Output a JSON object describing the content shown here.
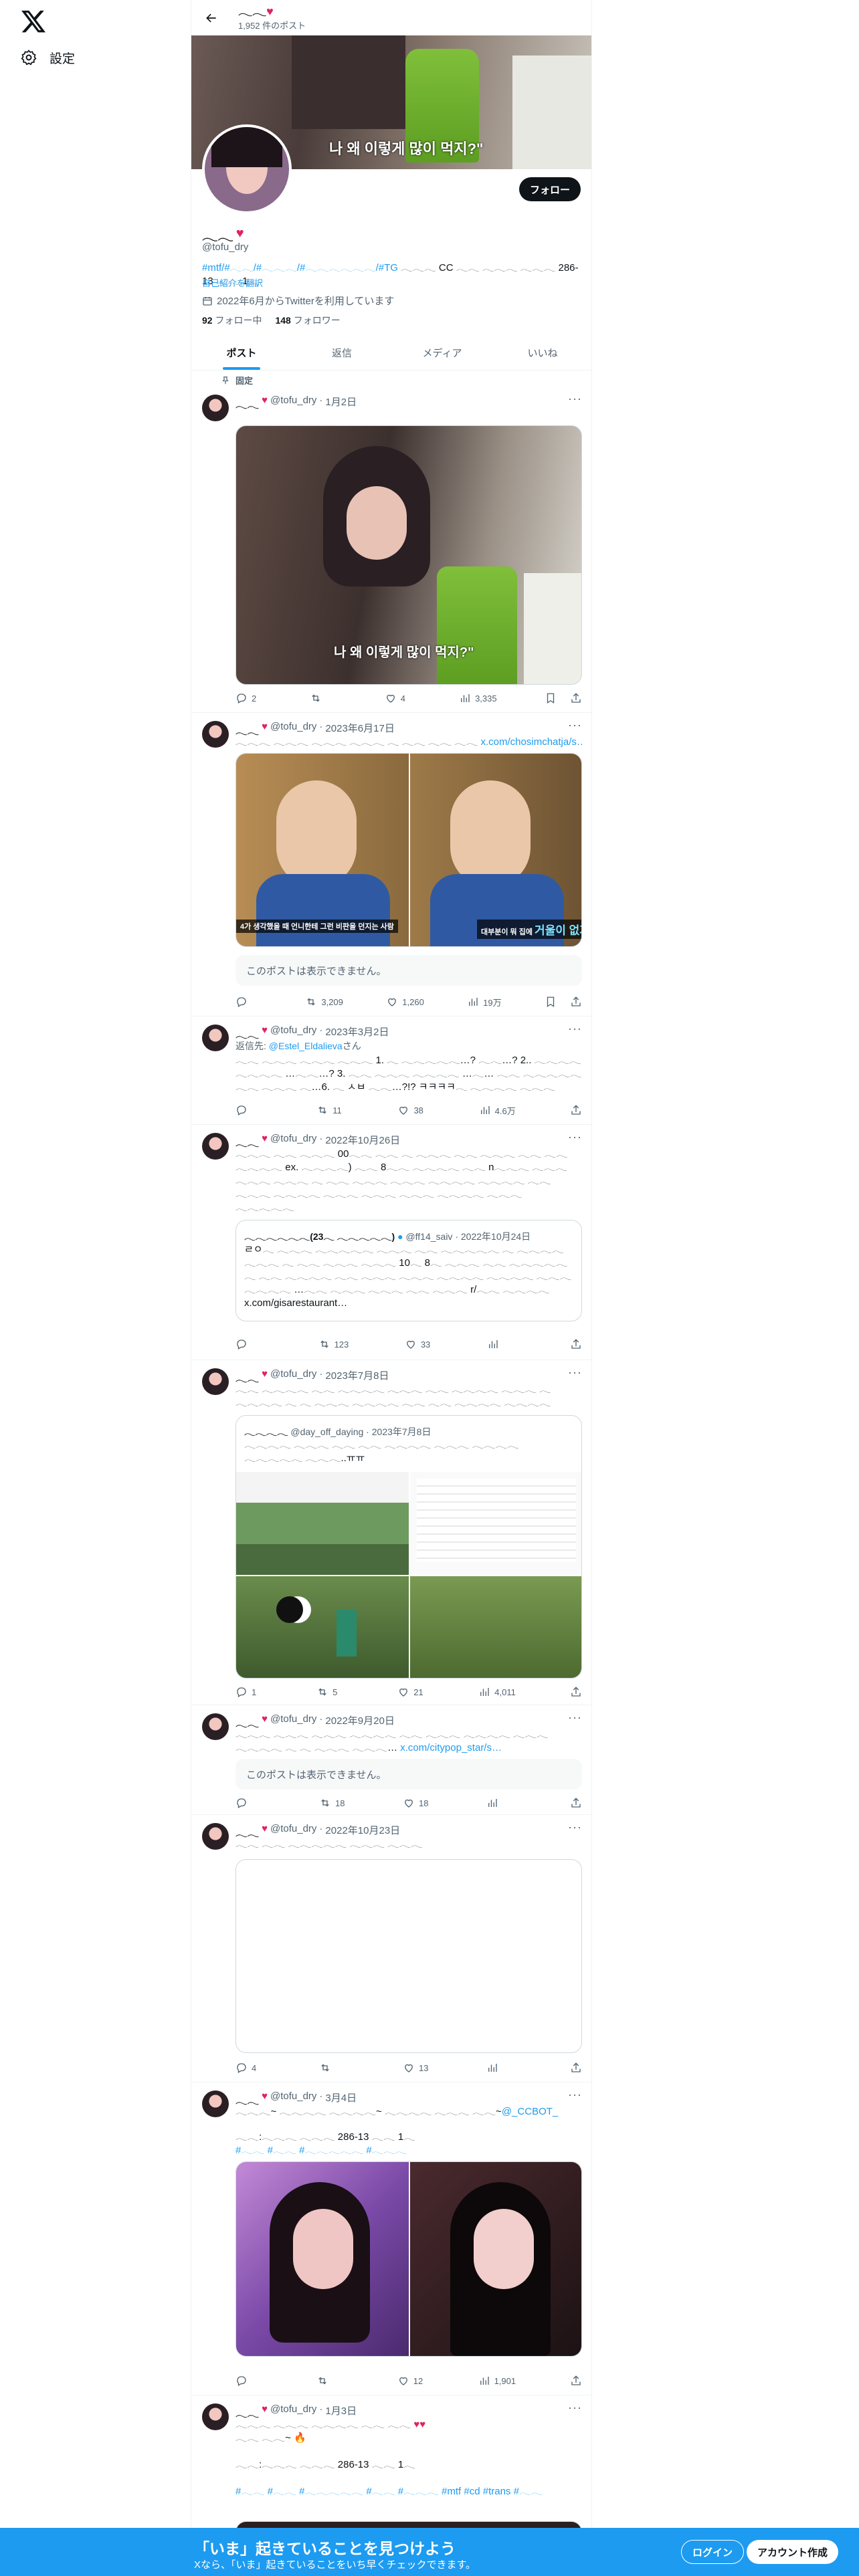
{
  "nav": {
    "settings_label": "設定"
  },
  "header": {
    "name": "𓂃𓂃",
    "post_count": "1,952 件のポスト"
  },
  "banner": {
    "caption": "나 왜 이렇게 많이 먹지?\""
  },
  "profile": {
    "name": "𓂃𓂃",
    "handle": "@tofu_dry",
    "bio_tags": "#mtf/#𓂃𓂃/#𓂃𓂃𓂃/#𓂃𓂃𓂃𓂃𓂃𓂃/#TG",
    "bio_text": " 𓂃𓂃𓂃 CC 𓂃𓂃 𓂃𓂃𓂃 𓂃𓂃𓂃 286-13 𓂃𓂃 1𓂃",
    "translate_label": "自己紹介を翻訳",
    "joined": "2022年6月からTwitterを利用しています",
    "following_count": "92",
    "following_label": "フォロー中",
    "followers_count": "148",
    "followers_label": "フォロワー",
    "follow_button": "フォロー"
  },
  "tabs": [
    "ポスト",
    "返信",
    "メディア",
    "いいね"
  ],
  "pinned_label": "固定",
  "hidden_post_text": "このポストは表示できません。",
  "tweets": [
    {
      "name": "𓂃𓂃",
      "handle": "@tofu_dry",
      "date": "1月2日",
      "text": "",
      "media_caption": "나 왜 이렇게 많이 먹지?\"",
      "replies": "2",
      "retweets": "",
      "likes": "4",
      "views": "3,335"
    },
    {
      "name": "𓂃𓂃",
      "handle": "@tofu_dry",
      "date": "2023年6月17日",
      "text": "𓂃𓂃𓂃 𓂃𓂃𓂃 𓂃𓂃𓂃 𓂃𓂃𓂃 𓂃 𓂃𓂃 𓂃𓂃 𓂃𓂃",
      "link": " x.com/chosimchatja/s…",
      "sub_left": "4가 생각했을 때 언니한테 그런 비판을 던지는 사람",
      "sub_right_small": "대부분이 뭐 집에",
      "sub_right_big": "거울이 없거나",
      "replies": "",
      "retweets": "3,209",
      "likes": "1,260",
      "views": "19万"
    },
    {
      "name": "𓂃𓂃",
      "handle": "@tofu_dry",
      "date": "2023年3月2日",
      "reply_to_label": "返信先: ",
      "reply_to": "@Estel_Eldalieva",
      "reply_suffix": "さん",
      "text": "𓂃𓂃 𓂃𓂃𓂃 𓂃𓂃𓂃 𓂃𓂃𓂃 1. 𓂃 𓂃𓂃𓂃𓂃𓂃…? 𓂃𓂃…? 2.. 𓂃𓂃𓂃𓂃 𓂃𓂃𓂃𓂃 …𓂃𓂃…? 3. 𓂃𓂃 𓂃𓂃𓂃 𓂃𓂃𓂃𓂃 …𓂃… 𓂃𓂃 𓂃𓂃𓂃𓂃𓂃 𓂃𓂃 𓂃𓂃𓂃 𓂃…6. 𓂃 ㅅㅂ 𓂃𓂃…?!? ㅋㅋㅋㅋ𓂃 𓂃𓂃𓂃𓂃 𓂃𓂃𓂃",
      "replies": "",
      "retweets": "11",
      "likes": "38",
      "views": "4.6万"
    },
    {
      "name": "𓂃𓂃",
      "handle": "@tofu_dry",
      "date": "2022年10月26日",
      "text": "𓂃𓂃𓂃 𓂃𓂃 𓂃𓂃𓂃 00𓂃𓂃 𓂃𓂃 𓂃 𓂃𓂃𓂃 𓂃𓂃 𓂃𓂃𓂃 𓂃𓂃 𓂃𓂃 𓂃𓂃𓂃𓂃 ex. 𓂃𓂃𓂃𓂃) 𓂃𓂃 8𓂃𓂃 𓂃𓂃𓂃𓂃 𓂃𓂃 n𓂃𓂃𓂃 𓂃𓂃𓂃 𓂃𓂃𓂃 𓂃𓂃𓂃 𓂃 𓂃𓂃 𓂃𓂃𓂃 𓂃𓂃𓂃 𓂃𓂃𓂃𓂃 𓂃𓂃𓂃𓂃 𓂃𓂃 𓂃𓂃𓂃 𓂃𓂃𓂃𓂃 𓂃𓂃𓂃 𓂃𓂃𓂃 𓂃𓂃𓂃 𓂃𓂃𓂃𓂃 𓂃𓂃𓂃 𓂃𓂃𓂃𓂃𓂃",
      "quote_name": "𓂃𓂃𓂃𓂃𓂃𓂃(23𓂃 𓂃𓂃𓂃𓂃𓂃)",
      "quote_handle": "@ff14_saiv",
      "quote_date": "2022年10月24日",
      "quote_text": "ㄹㅇ𓂃 𓂃𓂃𓂃 𓂃𓂃𓂃𓂃𓂃 𓂃𓂃𓂃 𓂃𓂃 𓂃𓂃𓂃𓂃𓂃 𓂃 𓂃𓂃𓂃𓂃 𓂃𓂃𓂃 𓂃 𓂃𓂃 𓂃𓂃𓂃 𓂃𓂃𓂃 10𓂃 8𓂃 𓂃𓂃𓂃 𓂃𓂃 𓂃𓂃𓂃𓂃𓂃 𓂃 𓂃𓂃 𓂃𓂃𓂃𓂃 𓂃𓂃 𓂃𓂃𓂃 𓂃𓂃𓂃 𓂃𓂃𓂃𓂃 𓂃𓂃𓂃𓂃 𓂃𓂃𓂃 𓂃𓂃𓂃𓂃 …𓂃𓂃 𓂃𓂃𓂃 𓂃𓂃𓂃 𓂃𓂃 𓂃𓂃𓂃 r/𓂃𓂃 𓂃𓂃𓂃𓂃 x.com/gisarestaurant…",
      "replies": "",
      "retweets": "123",
      "likes": "33",
      "views": ""
    },
    {
      "name": "𓂃𓂃",
      "handle": "@tofu_dry",
      "date": "2023年7月8日",
      "text": "𓂃𓂃 𓂃𓂃𓂃𓂃 𓂃𓂃 𓂃𓂃𓂃𓂃 𓂃𓂃𓂃 𓂃𓂃 𓂃𓂃𓂃𓂃 𓂃𓂃𓂃 𓂃 𓂃𓂃𓂃𓂃 𓂃 𓂃 𓂃𓂃𓂃 𓂃𓂃𓂃𓂃 𓂃𓂃 𓂃𓂃 𓂃𓂃𓂃𓂃 𓂃𓂃𓂃𓂃",
      "quote_name": "𓂃𓂃𓂃𓂃",
      "quote_handle": "@day_off_daying",
      "quote_date": "2023年7月8日",
      "quote_text": "𓂃𓂃𓂃𓂃 𓂃𓂃𓂃 𓂃𓂃 𓂃𓂃 𓂃𓂃𓂃𓂃 𓂃𓂃𓂃 𓂃𓂃𓂃𓂃 𓂃𓂃𓂃𓂃𓂃 𓂃𓂃𓂃..ㅠㅠ",
      "replies": "1",
      "retweets": "5",
      "likes": "21",
      "views": "4,011"
    },
    {
      "name": "𓂃𓂃",
      "handle": "@tofu_dry",
      "date": "2022年9月20日",
      "text": "𓂃𓂃𓂃 𓂃𓂃𓂃 𓂃𓂃𓂃 𓂃𓂃𓂃𓂃 𓂃𓂃 𓂃𓂃𓂃 𓂃𓂃𓂃𓂃 𓂃𓂃𓂃 𓂃𓂃𓂃𓂃 𓂃 𓂃 𓂃𓂃𓂃 𓂃𓂃𓂃…",
      "link": " x.com/citypop_star/s…",
      "replies": "",
      "retweets": "18",
      "likes": "18",
      "views": ""
    },
    {
      "name": "𓂃𓂃",
      "handle": "@tofu_dry",
      "date": "2022年10月23日",
      "text": "𓂃𓂃 𓂃𓂃 𓂃𓂃𓂃𓂃𓂃 𓂃𓂃𓂃 𓂃𓂃𓂃",
      "replies": "4",
      "retweets": "",
      "likes": "13",
      "views": ""
    },
    {
      "name": "𓂃𓂃",
      "handle": "@tofu_dry",
      "date": "3月4日",
      "text": "𓂃𓂃𓂃~ 𓂃𓂃𓂃𓂃 𓂃𓂃𓂃𓂃~ 𓂃𓂃𓂃𓂃 𓂃𓂃𓂃 𓂃𓂃~",
      "mention": "@_CCBOT_",
      "text2": "𓂃𓂃:𓂃𓂃𓂃 𓂃𓂃𓂃 286-13 𓂃𓂃 1𓂃",
      "tags": "#𓂃𓂃 #𓂃𓂃 #𓂃𓂃𓂃𓂃𓂃 #𓂃𓂃𓂃",
      "replies": "",
      "retweets": "",
      "likes": "12",
      "views": "1,901"
    },
    {
      "name": "𓂃𓂃",
      "handle": "@tofu_dry",
      "date": "1月3日",
      "text": "𓂃𓂃𓂃 𓂃𓂃𓂃 𓂃𓂃𓂃𓂃 𓂃𓂃 𓂃𓂃",
      "text_b": "𓂃𓂃 𓂃𓂃~",
      "text2": "𓂃𓂃:𓂃𓂃𓂃 𓂃𓂃𓂃 286-13 𓂃𓂃 1𓂃",
      "tags": "#𓂃𓂃 #𓂃𓂃 #𓂃𓂃𓂃𓂃𓂃 #𓂃𓂃 #𓂃𓂃𓂃 #mtf #cd #trans #𓂃𓂃"
    }
  ],
  "bottom_bar": {
    "title": "「いま」起きていることを見つけよう",
    "subtitle": "Xなら、「いま」起きていることをいち早くチェックできます。",
    "login": "ログイン",
    "signup": "アカウント作成"
  }
}
